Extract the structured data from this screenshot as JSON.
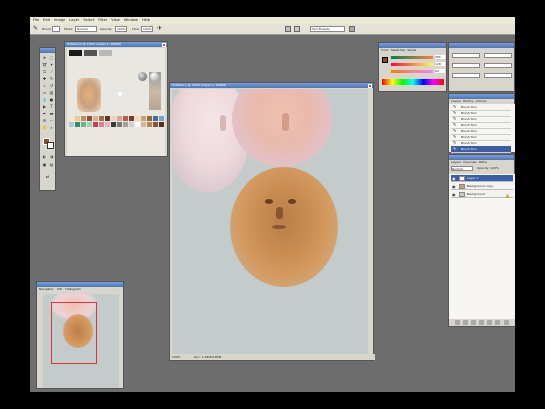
{
  "menu": [
    "File",
    "Edit",
    "Image",
    "Layer",
    "Select",
    "Filter",
    "View",
    "Window",
    "Help"
  ],
  "options": {
    "brush_label": "Brush:",
    "mode_label": "Mode:",
    "mode_value": "Normal",
    "opacity_label": "Opacity:",
    "opacity_value": "100%",
    "flow_label": "Flow:",
    "flow_value": "100%",
    "workspace": "Tool Presets"
  },
  "swatch_window": {
    "title": "Untitled-1 @ 100% (Layer 1, RGB/8)",
    "colors": [
      "#1a1a1a",
      "#555555",
      "#b8b8b8",
      "#e8e8e8",
      "#f5e6c8",
      "#e9c9a0",
      "#c78a5a",
      "#8a5030",
      "#d9b08c",
      "#a0724a",
      "#5a3a24",
      "#f0d0c0",
      "#e0a090",
      "#b86050",
      "#7a3a2a",
      "#f2d8b4",
      "#caa070",
      "#93683e",
      "#4a6a90",
      "#80a0c0",
      "#b0c8e0",
      "#3a8a6a",
      "#70b090",
      "#a0d0b0",
      "#c04060",
      "#e08098",
      "#f0b0c0",
      "#3a3a3a",
      "#7a7a7a",
      "#a0a0a0",
      "#d0d0d0",
      "#ffffff",
      "#d8b890",
      "#bb8855",
      "#885533",
      "#553322"
    ]
  },
  "document": {
    "title": "Untitled-1 @ 100% (Layer 1, RGB/8)",
    "zoom": "100%",
    "status": "Doc: 1.54M/4.85M"
  },
  "navigator": {
    "tabs": [
      "Navigator",
      "Info",
      "Histogram"
    ]
  },
  "color_panel": {
    "tabs": [
      "Color",
      "Swatches",
      "Styles"
    ],
    "channels": [
      "R",
      "G",
      "B"
    ],
    "values": [
      "255",
      "128",
      "64"
    ]
  },
  "history": {
    "tabs": [
      "Layers",
      "History",
      "Actions"
    ],
    "items": [
      "Brush Tool",
      "Brush Tool",
      "Brush Tool",
      "Brush Tool",
      "Brush Tool",
      "Brush Tool",
      "Brush Tool",
      "Brush Tool"
    ]
  },
  "layers": {
    "tabs": [
      "Layers",
      "Channels",
      "Paths"
    ],
    "blend": "Normal",
    "opacity": "Opacity: 100%",
    "items": [
      "Layer 1",
      "Background copy",
      "Background"
    ]
  }
}
